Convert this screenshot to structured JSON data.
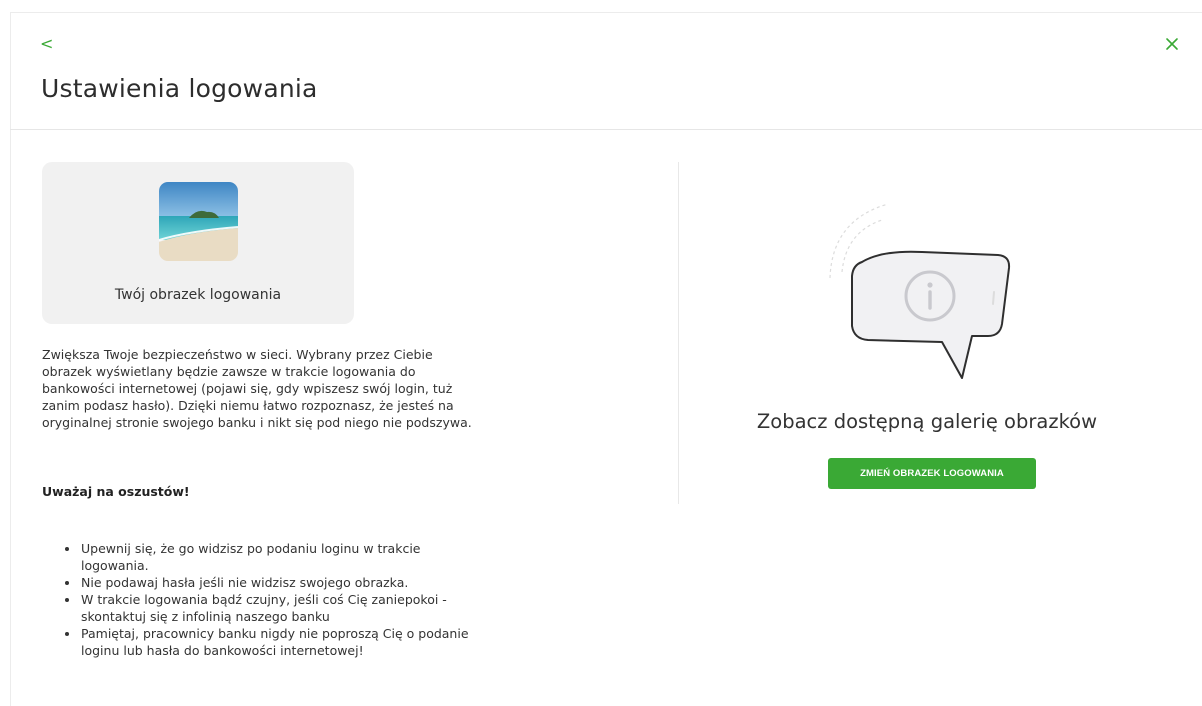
{
  "header": {
    "back_icon": "chevron-left-icon",
    "back_glyph": "<",
    "close_icon": "close-icon",
    "title": "Ustawienia logowania"
  },
  "login_image": {
    "label": "Twój obrazek logowania",
    "image_desc_icon": "beach-photo-icon"
  },
  "description": "Zwiększa Twoje bezpieczeństwo w sieci. Wybrany przez Ciebie obrazek wyświetlany będzie zawsze w trakcie logowania do bankowości internetowej (pojawi się, gdy wpiszesz swój login, tuż zanim podasz hasło). Dzięki niemu łatwo rozpoznasz, że jesteś na oryginalnej stronie swojego banku i nikt się pod niego nie podszywa.",
  "warning": {
    "title": "Uważaj na oszustów!",
    "tips": [
      "Upewnij się, że go widzisz po podaniu loginu w trakcie logowania.",
      "Nie podawaj hasła jeśli nie widzisz swojego obrazka.",
      "W trakcie logowania bądź czujny, jeśli coś Cię zaniepokoi - skontaktuj się z infolinią naszego banku",
      "Pamiętaj, pracownicy banku nigdy nie poproszą Cię o podanie loginu lub hasła do bankowości internetowej!"
    ]
  },
  "gallery": {
    "illustration_icon": "info-speech-bubble-icon",
    "title": "Zobacz dostępną galerię obrazków",
    "button_label": "ZMIEŃ OBRAZEK LOGOWANIA"
  },
  "colors": {
    "accent": "#3aa935",
    "card_bg": "#f1f1f1",
    "divider": "#e6e6e6"
  }
}
